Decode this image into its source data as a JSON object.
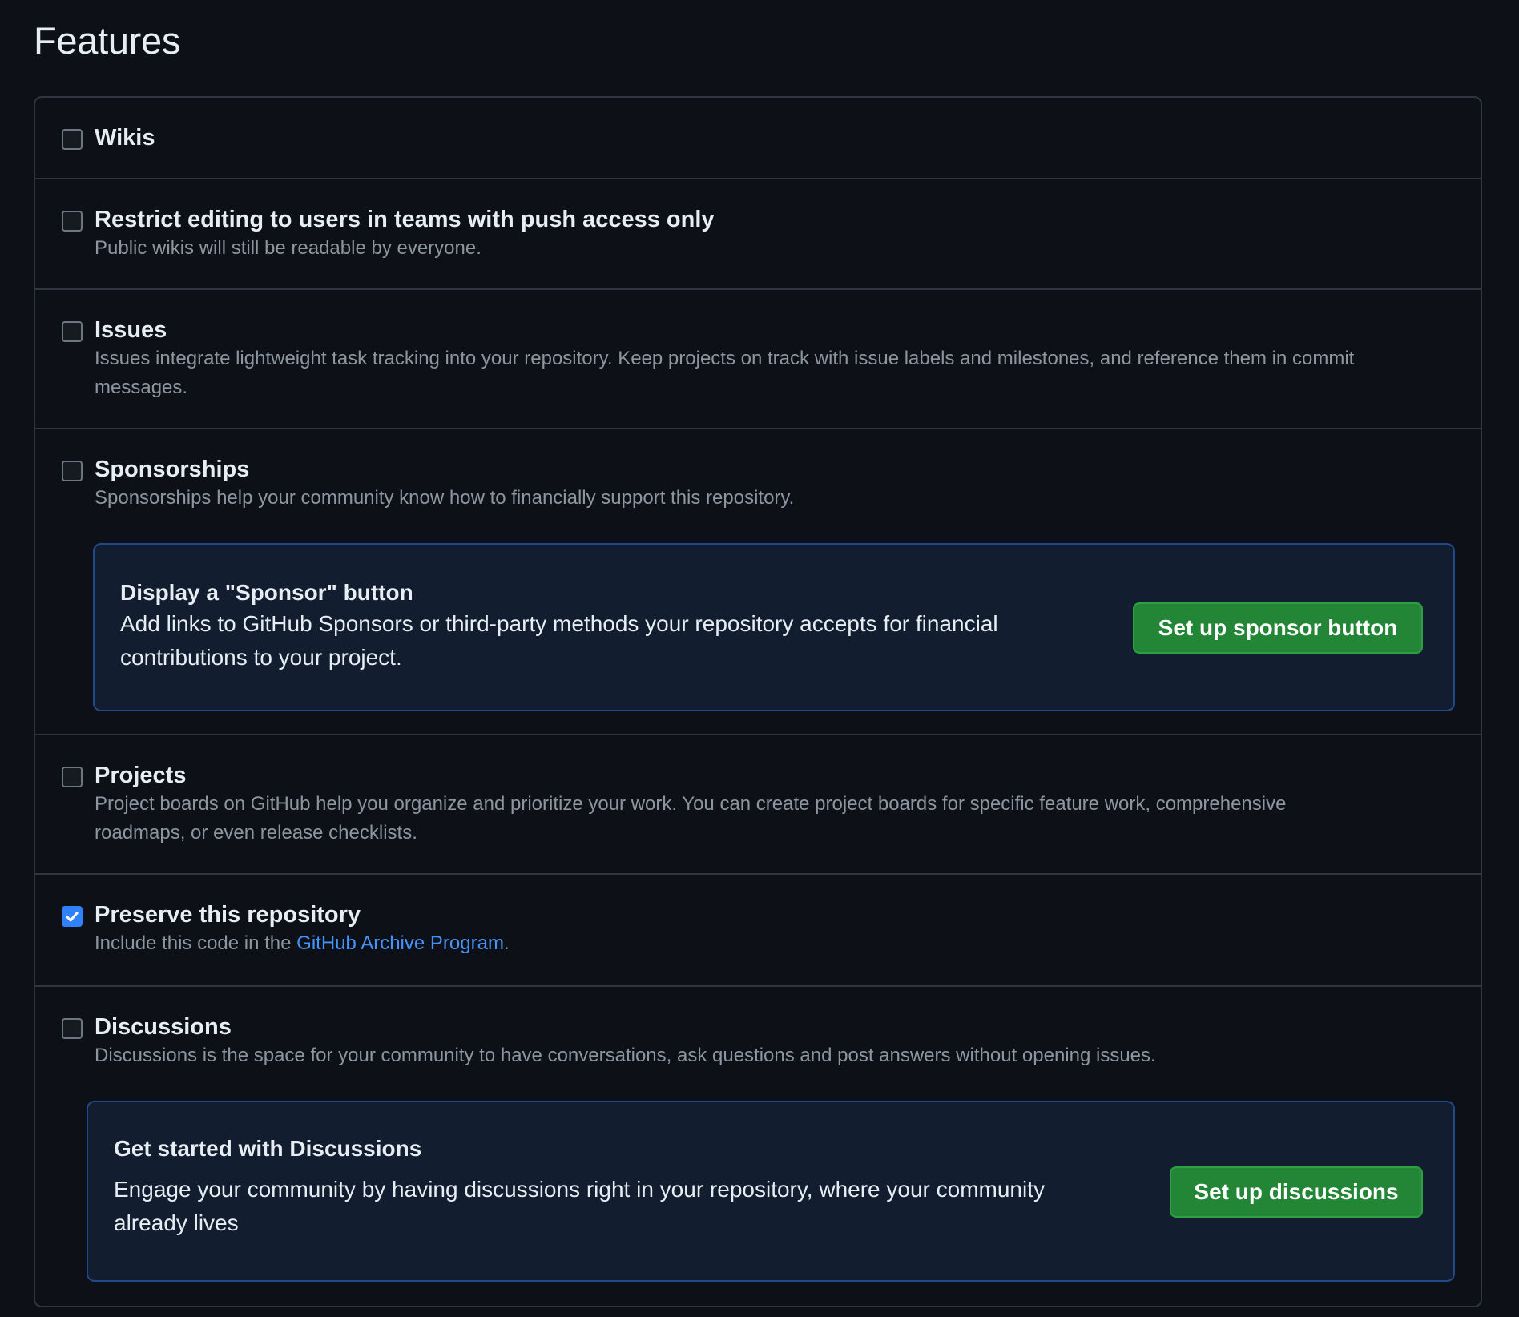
{
  "section": {
    "title": "Features"
  },
  "features": {
    "wikis": {
      "label": "Wikis",
      "checked": false
    },
    "restrict_editing": {
      "label": "Restrict editing to users in teams with push access only",
      "description": "Public wikis will still be readable by everyone.",
      "checked": false
    },
    "issues": {
      "label": "Issues",
      "description_line1": "Issues integrate lightweight task tracking into your repository. Keep projects on track with issue labels and milestones, and reference them in commit",
      "description_line2": "messages.",
      "checked": false
    },
    "sponsorships": {
      "label": "Sponsorships",
      "description": "Sponsorships help your community know how to financially support this repository.",
      "checked": false,
      "callout": {
        "title": "Display a \"Sponsor\" button",
        "text_line1": "Add links to GitHub Sponsors or third-party methods your repository accepts for financial",
        "text_line2": "contributions to your project.",
        "button_label": "Set up sponsor button"
      }
    },
    "projects": {
      "label": "Projects",
      "description_line1": "Project boards on GitHub help you organize and prioritize your work. You can create project boards for specific feature work, comprehensive",
      "description_line2": "roadmaps, or even release checklists.",
      "checked": false
    },
    "preserve": {
      "label": "Preserve this repository",
      "description_prefix": "Include this code in the ",
      "link_text": "GitHub Archive Program",
      "description_suffix": ".",
      "checked": true
    },
    "discussions": {
      "label": "Discussions",
      "description": "Discussions is the space for your community to have conversations, ask questions and post answers without opening issues.",
      "checked": false,
      "callout": {
        "title": "Get started with Discussions",
        "text_line1": "Engage your community by having discussions right in your repository, where your community",
        "text_line2": "already lives",
        "button_label": "Set up discussions"
      }
    }
  },
  "colors": {
    "background": "#0d1117",
    "border": "#30363d",
    "primary_button": "#238636",
    "link": "#4493f8",
    "checkbox_checked": "#2f81f7"
  }
}
